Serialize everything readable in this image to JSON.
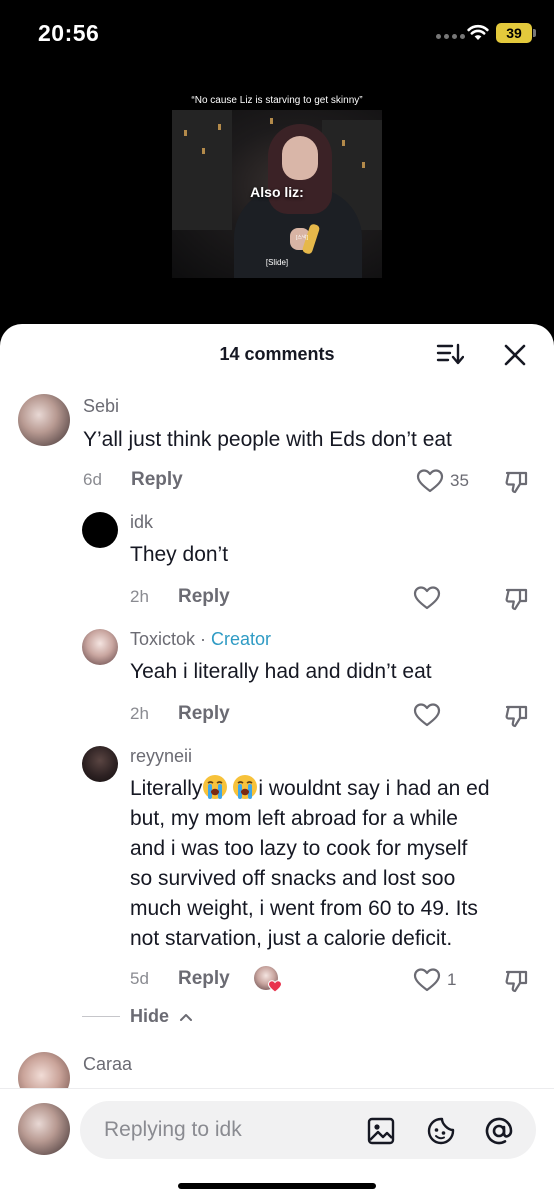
{
  "status_bar": {
    "time": "20:56",
    "battery": "39",
    "battery_color": "#e3c93c"
  },
  "video": {
    "caption": "“No cause Liz is starving to get skinny”",
    "overlay_text": "Also liz:",
    "small_tag": "[스낵]",
    "slide_label": "[Slide]"
  },
  "sheet": {
    "comment_count": "14 comments",
    "sort_icon": "sort-icon",
    "close_icon": "close-icon"
  },
  "comments": [
    {
      "username": "Sebi",
      "text": "Y’all just think people with Eds don’t eat",
      "age": "6d",
      "reply_label": "Reply",
      "likes": "35"
    },
    {
      "username": "idk",
      "text": "They don’t",
      "age": "2h",
      "reply_label": "Reply",
      "likes": ""
    },
    {
      "username": "Toxictok",
      "separator": " · ",
      "badge": "Creator",
      "text": "Yeah i literally had and didn’t eat",
      "age": "2h",
      "reply_label": "Reply",
      "likes": ""
    },
    {
      "username": "reyyneii",
      "text_start": "Literally",
      "text_line1_end": "i wouldnt say i had an ed",
      "text_rest": [
        "but, my mom left abroad for a while",
        "and i was too lazy to cook for myself",
        "so survived off snacks and lost soo",
        "much weight, i went from 60 to 49. Its",
        "not starvation, just a calorie deficit."
      ],
      "emoji": "loudly-crying-face",
      "age": "5d",
      "reply_label": "Reply",
      "likes": "1"
    },
    {
      "username": "Caraa"
    }
  ],
  "hide_label": "Hide",
  "composer": {
    "placeholder": "Replying to idk",
    "icons": [
      "image-icon",
      "sticker-icon",
      "mention-icon"
    ]
  },
  "colors": {
    "creator_badge": "#2f9bc4",
    "creator_liked_heart": "#e8344e",
    "text": "#161823",
    "muted": "#6b6b73"
  }
}
